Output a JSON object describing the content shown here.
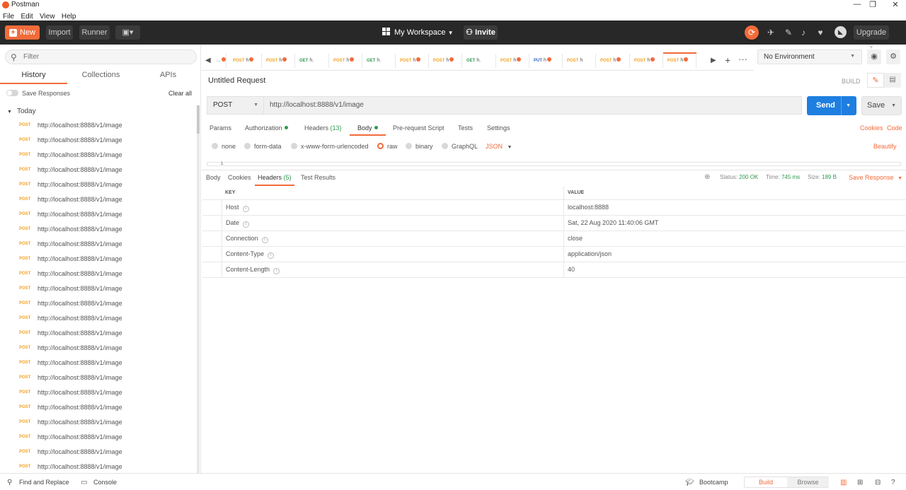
{
  "window": {
    "title": "Postman",
    "minimize": "—",
    "maximize": "❐",
    "close": "✕"
  },
  "menu": [
    "File",
    "Edit",
    "View",
    "Help"
  ],
  "toolbar": {
    "new_label": "New",
    "import_label": "Import",
    "runner_label": "Runner",
    "workspace_label": "My Workspace",
    "invite_label": "Invite",
    "upgrade_label": "Upgrade"
  },
  "sidebar": {
    "filter_placeholder": "Filter",
    "tabs": [
      "History",
      "Collections",
      "APIs"
    ],
    "active_tab": "History",
    "save_responses_label": "Save Responses",
    "clear_all_label": "Clear all",
    "group_label": "Today",
    "history": [
      {
        "method": "POST",
        "url": "http://localhost:8888/v1/image"
      },
      {
        "method": "POST",
        "url": "http://localhost:8888/v1/image"
      },
      {
        "method": "POST",
        "url": "http://localhost:8888/v1/image"
      },
      {
        "method": "POST",
        "url": "http://localhost:8888/v1/image"
      },
      {
        "method": "POST",
        "url": "http://localhost:8888/v1/image"
      },
      {
        "method": "POST",
        "url": "http://localhost:8888/v1/image"
      },
      {
        "method": "POST",
        "url": "http://localhost:8888/v1/image"
      },
      {
        "method": "POST",
        "url": "http://localhost:8888/v1/image"
      },
      {
        "method": "POST",
        "url": "http://localhost:8888/v1/image"
      },
      {
        "method": "POST",
        "url": "http://localhost:8888/v1/image"
      },
      {
        "method": "POST",
        "url": "http://localhost:8888/v1/image"
      },
      {
        "method": "POST",
        "url": "http://localhost:8888/v1/image"
      },
      {
        "method": "POST",
        "url": "http://localhost:8888/v1/image"
      },
      {
        "method": "POST",
        "url": "http://localhost:8888/v1/image"
      },
      {
        "method": "POST",
        "url": "http://localhost:8888/v1/image"
      },
      {
        "method": "POST",
        "url": "http://localhost:8888/v1/image"
      },
      {
        "method": "POST",
        "url": "http://localhost:8888/v1/image"
      },
      {
        "method": "POST",
        "url": "http://localhost:8888/v1/image"
      },
      {
        "method": "POST",
        "url": "http://localhost:8888/v1/image"
      },
      {
        "method": "POST",
        "url": "http://localhost:8888/v1/image"
      },
      {
        "method": "POST",
        "url": "http://localhost:8888/v1/image"
      },
      {
        "method": "POST",
        "url": "http://localhost:8888/v1/image"
      },
      {
        "method": "POST",
        "url": "http://localhost:8888/v1/image"
      },
      {
        "method": "POST",
        "url": "http://localhost:8888/v1/image"
      }
    ]
  },
  "request_tabs": [
    {
      "method": "",
      "name": "...",
      "dot": true
    },
    {
      "method": "POST",
      "name": "h",
      "dot": true
    },
    {
      "method": "POST",
      "name": "h",
      "dot": true
    },
    {
      "method": "GET",
      "name": "h.",
      "dot": false
    },
    {
      "method": "POST",
      "name": "h",
      "dot": true
    },
    {
      "method": "GET",
      "name": "h.",
      "dot": false
    },
    {
      "method": "POST",
      "name": "h",
      "dot": true
    },
    {
      "method": "POST",
      "name": "h",
      "dot": true
    },
    {
      "method": "GET",
      "name": "h.",
      "dot": false
    },
    {
      "method": "POST",
      "name": "h",
      "dot": true
    },
    {
      "method": "PUT",
      "name": "h",
      "dot": true
    },
    {
      "method": "POST",
      "name": "h",
      "dot": false
    },
    {
      "method": "POST",
      "name": "h",
      "dot": true
    },
    {
      "method": "POST",
      "name": "h",
      "dot": true
    },
    {
      "method": "POST",
      "name": "h",
      "dot": true
    }
  ],
  "environment": {
    "selected": "No Environment"
  },
  "request": {
    "title": "Untitled Request",
    "build_label": "BUILD",
    "method": "POST",
    "url": "http://localhost:8888/v1/image",
    "send_label": "Send",
    "save_label": "Save",
    "tabs": {
      "params": "Params",
      "authorization": "Authorization",
      "headers": "Headers",
      "headers_count": "(13)",
      "body": "Body",
      "prerequest": "Pre-request Script",
      "tests": "Tests",
      "settings": "Settings"
    },
    "cookies_label": "Cookies",
    "code_label": "Code",
    "body_types": [
      "none",
      "form-data",
      "x-www-form-urlencoded",
      "raw",
      "binary",
      "GraphQL"
    ],
    "selected_body_type": "raw",
    "format": "JSON",
    "beautify_label": "Beautify",
    "line_number": "1"
  },
  "response": {
    "tabs": {
      "body": "Body",
      "cookies": "Cookies",
      "headers": "Headers",
      "headers_count": "(5)",
      "test_results": "Test Results"
    },
    "status_label": "Status:",
    "status": "200 OK",
    "time_label": "Time:",
    "time": "745 ms",
    "size_label": "Size:",
    "size": "189 B",
    "save_response_label": "Save Response",
    "table": {
      "key_header": "KEY",
      "value_header": "VALUE",
      "rows": [
        {
          "key": "Host",
          "value": "localhost:8888"
        },
        {
          "key": "Date",
          "value": "Sat, 22 Aug 2020 11:40:06 GMT"
        },
        {
          "key": "Connection",
          "value": "close"
        },
        {
          "key": "Content-Type",
          "value": "application/json"
        },
        {
          "key": "Content-Length",
          "value": "40"
        }
      ]
    }
  },
  "statusbar": {
    "find_replace": "Find and Replace",
    "console": "Console",
    "bootcamp": "Bootcamp",
    "build": "Build",
    "browse": "Browse"
  },
  "colors": {
    "accent": "#f26b3a",
    "send": "#1e7fe0",
    "post": "#f4a223",
    "get": "#2f9a4f",
    "put": "#3465c9"
  }
}
